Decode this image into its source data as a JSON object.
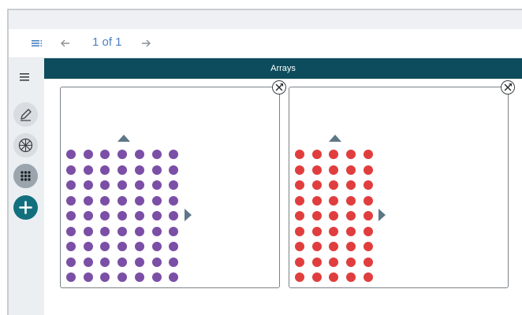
{
  "navigation": {
    "page_indicator": "1 of 1",
    "icons": [
      "list-icon",
      "arrow-left-icon",
      "arrow-right-icon"
    ]
  },
  "sidebar": {
    "tools": [
      "menu-icon",
      "pencil-icon",
      "reel-icon",
      "dot-grid-icon",
      "add-icon"
    ]
  },
  "workspace": {
    "title": "Arrays",
    "arrays": [
      {
        "rows": 9,
        "cols": 7,
        "color": "#7b4fa6"
      },
      {
        "rows": 9,
        "cols": 5,
        "color": "#e03e3e"
      }
    ]
  },
  "colors": {
    "header": "#0d4c5c",
    "accent": "#4a7fc1",
    "add_button": "#12707e",
    "handle": "#5e7786"
  }
}
